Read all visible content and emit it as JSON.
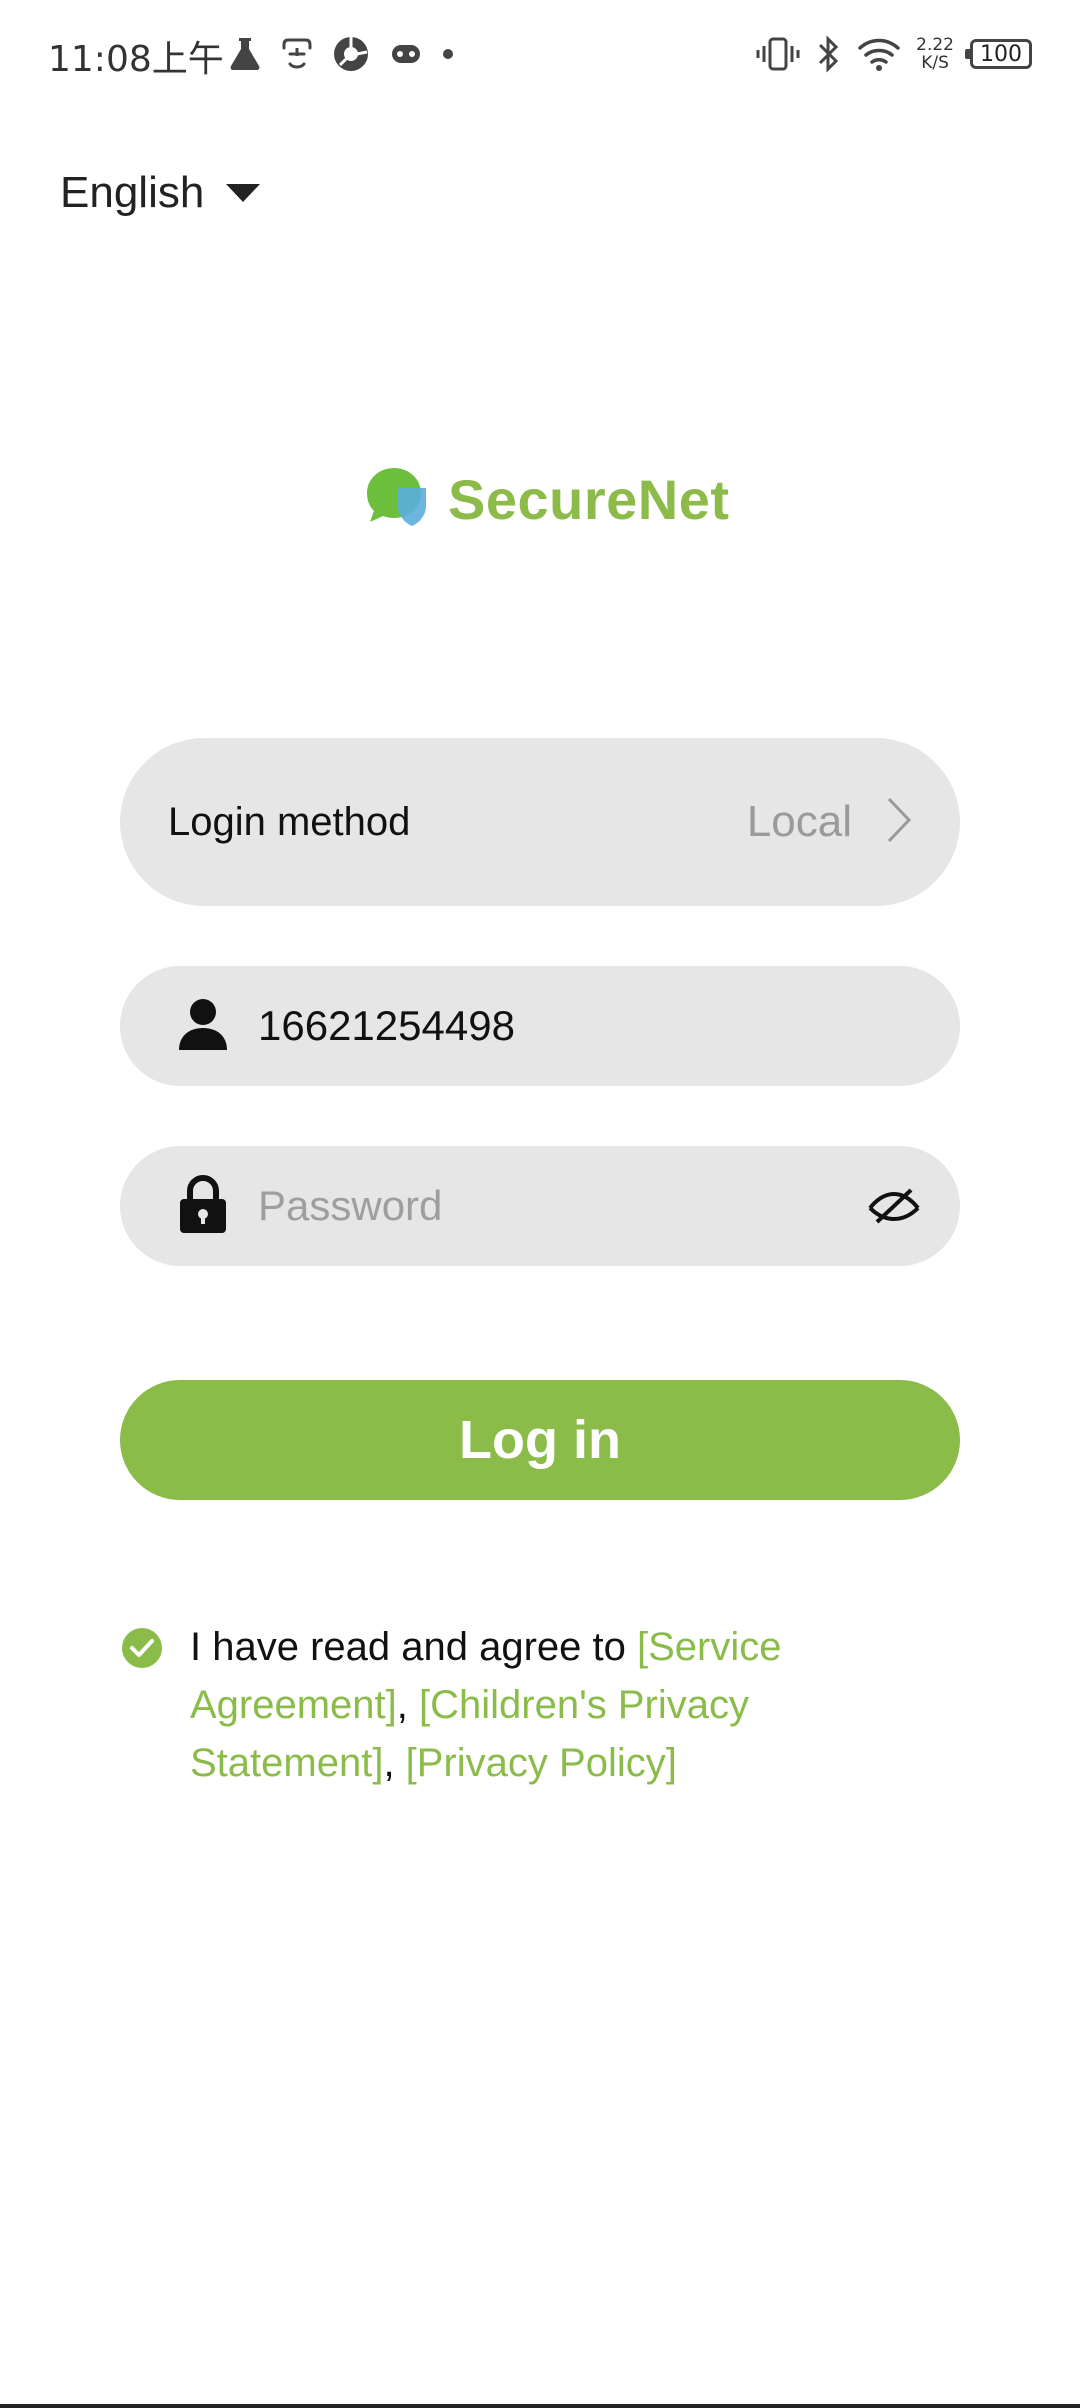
{
  "status_bar": {
    "time": "11:08上午",
    "net_speed_value": "2.22",
    "net_speed_unit": "K/S",
    "battery": "100",
    "icons_left": [
      "flask-icon",
      "face-id-icon",
      "shutter-app-icon",
      "gamepad-icon",
      "dot-icon"
    ],
    "icons_right": [
      "vibrate-icon",
      "bluetooth-icon",
      "wifi-icon",
      "net-speed",
      "battery-icon"
    ]
  },
  "language": {
    "selected": "English"
  },
  "brand": {
    "name": "SecureNet",
    "color": "#8cbb49"
  },
  "login_method": {
    "label": "Login method",
    "value": "Local"
  },
  "username": {
    "value": "16621254498"
  },
  "password": {
    "value": "",
    "placeholder": "Password"
  },
  "login_button": {
    "label": "Log in",
    "color": "#8bbc4a"
  },
  "agreement": {
    "prefix": "I have read and agree to ",
    "link1": "[Service Agreement]",
    "sep1": ", ",
    "link2": "[Children's Privacy Statement]",
    "sep2": ", ",
    "link3": "[Privacy Policy]",
    "checked": true
  }
}
